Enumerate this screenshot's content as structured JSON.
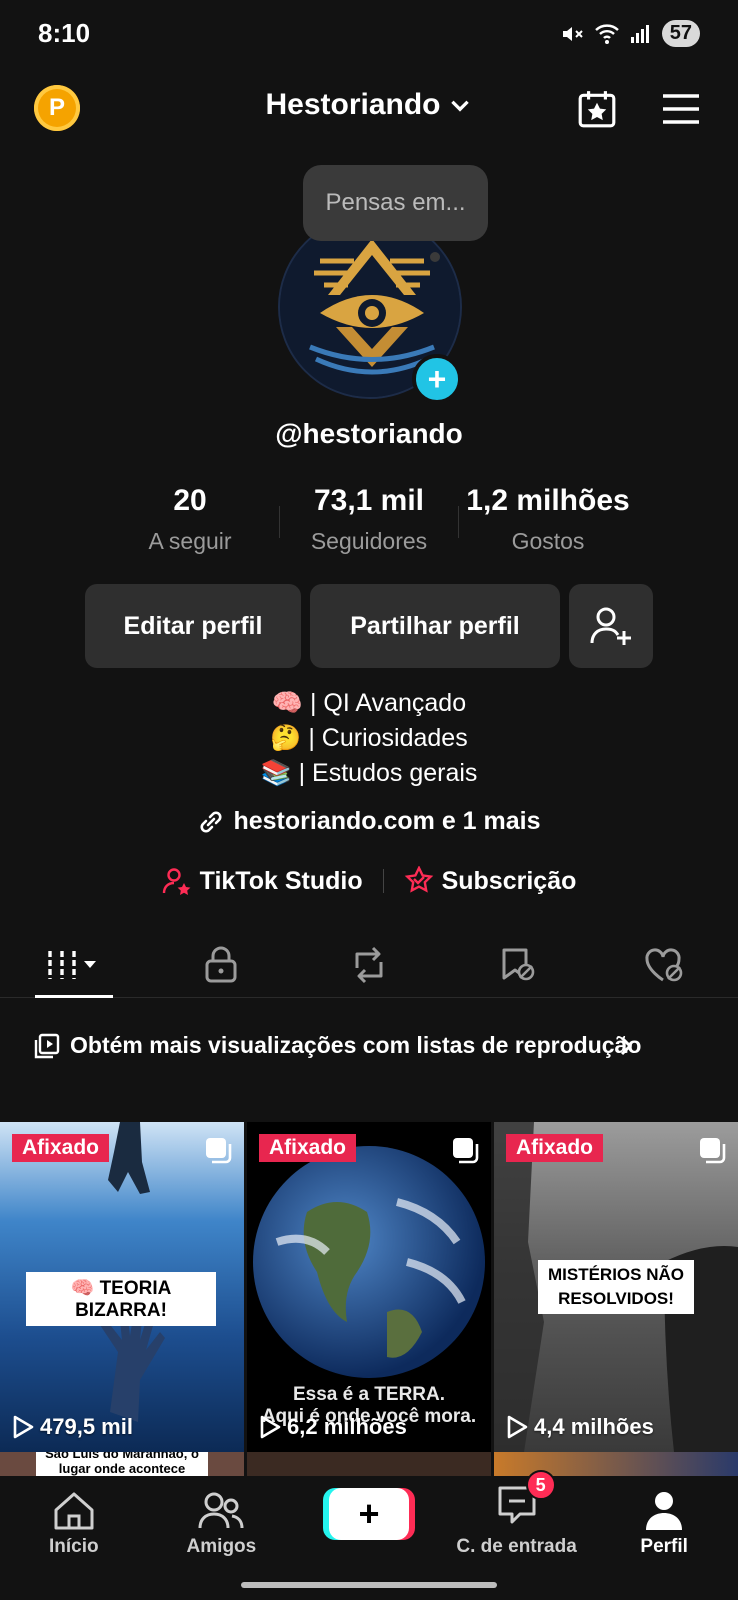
{
  "status": {
    "time": "8:10",
    "battery": "57"
  },
  "header": {
    "username_title": "Hestoriando",
    "coin_letter": "P"
  },
  "bubble": {
    "placeholder": "Pensas em..."
  },
  "profile": {
    "handle": "@hestoriando"
  },
  "stats": [
    {
      "value": "20",
      "label": "A seguir"
    },
    {
      "value": "73,1 mil",
      "label": "Seguidores"
    },
    {
      "value": "1,2 milhões",
      "label": "Gostos"
    }
  ],
  "buttons": {
    "edit": "Editar perfil",
    "share": "Partilhar perfil"
  },
  "bio": [
    "🧠 | QI Avançado",
    "🤔 | Curiosidades",
    "📚 | Estudos gerais"
  ],
  "link": {
    "text": "hestoriando.com e 1 mais"
  },
  "shortcuts": {
    "studio": "TikTok Studio",
    "subscription": "Subscrição"
  },
  "promo": {
    "text": "Obtém mais visualizações com listas de reprodução"
  },
  "videos": [
    {
      "pinned_label": "Afixado",
      "views": "479,5 mil",
      "caption": "🧠 TEORIA BIZARRA!"
    },
    {
      "pinned_label": "Afixado",
      "views": "6,2 milhões",
      "caption_line1": "Essa é a TERRA.",
      "caption_line2": "Aqui é onde você mora."
    },
    {
      "pinned_label": "Afixado",
      "views": "4,4 milhões",
      "caption_line1": "MISTÉRIOS NÃO",
      "caption_line2": "RESOLVIDOS!"
    }
  ],
  "row2": [
    {
      "caption_line1": "São Luís do Maranhão, o",
      "caption_line2": "lugar onde acontece"
    }
  ],
  "nav": {
    "home": "Início",
    "friends": "Amigos",
    "inbox": "C. de entrada",
    "inbox_badge": "5",
    "profile": "Perfil"
  },
  "colors": {
    "accent": "#fe2c55",
    "cyan": "#25f4ee",
    "pin": "#e8264f",
    "background": "#121212"
  }
}
